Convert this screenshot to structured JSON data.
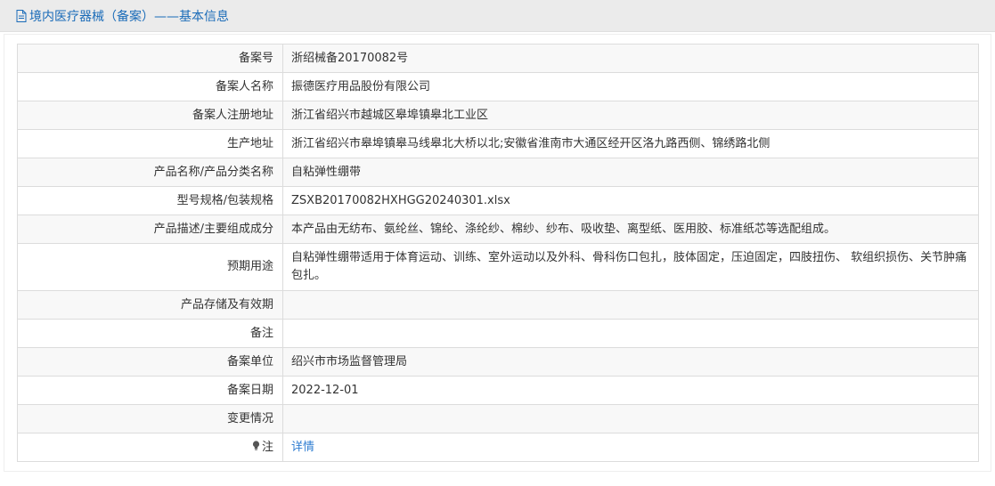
{
  "header": {
    "title": "境内医疗器械（备案）——基本信息",
    "icon": "document-icon"
  },
  "colors": {
    "title_blue": "#1a6bb8",
    "link_blue": "#2f7dd1",
    "header_bg": "#ebebeb",
    "row_alt_bg": "#f8f8f8",
    "border": "#dcdcdc"
  },
  "rows": [
    {
      "label": "备案号",
      "value": "浙绍械备20170082号"
    },
    {
      "label": "备案人名称",
      "value": "振德医疗用品股份有限公司"
    },
    {
      "label": "备案人注册地址",
      "value": "浙江省绍兴市越城区皋埠镇皋北工业区"
    },
    {
      "label": "生产地址",
      "value": "浙江省绍兴市皋埠镇皋马线皋北大桥以北;安徽省淮南市大通区经开区洛九路西侧、锦绣路北侧"
    },
    {
      "label": "产品名称/产品分类名称",
      "value": "自粘弹性绷带"
    },
    {
      "label": "型号规格/包装规格",
      "value": "ZSXB20170082HXHGG20240301.xlsx"
    },
    {
      "label": "产品描述/主要组成成分",
      "value": "本产品由无纺布、氨纶丝、锦纶、涤纶纱、棉纱、纱布、吸收垫、离型纸、医用胶、标准纸芯等选配组成。"
    },
    {
      "label": "预期用途",
      "value": "自粘弹性绷带适用于体育运动、训练、室外运动以及外科、骨科伤口包扎，肢体固定，压迫固定，四肢扭伤、 软组织损伤、关节肿痛包扎。"
    },
    {
      "label": "产品存储及有效期",
      "value": ""
    },
    {
      "label": "备注",
      "value": ""
    },
    {
      "label": "备案单位",
      "value": "绍兴市市场监督管理局"
    },
    {
      "label": "备案日期",
      "value": "2022-12-01"
    },
    {
      "label": "变更情况",
      "value": ""
    }
  ],
  "note_row": {
    "label": "注",
    "icon": "lightbulb-icon",
    "link_text": "详情"
  }
}
